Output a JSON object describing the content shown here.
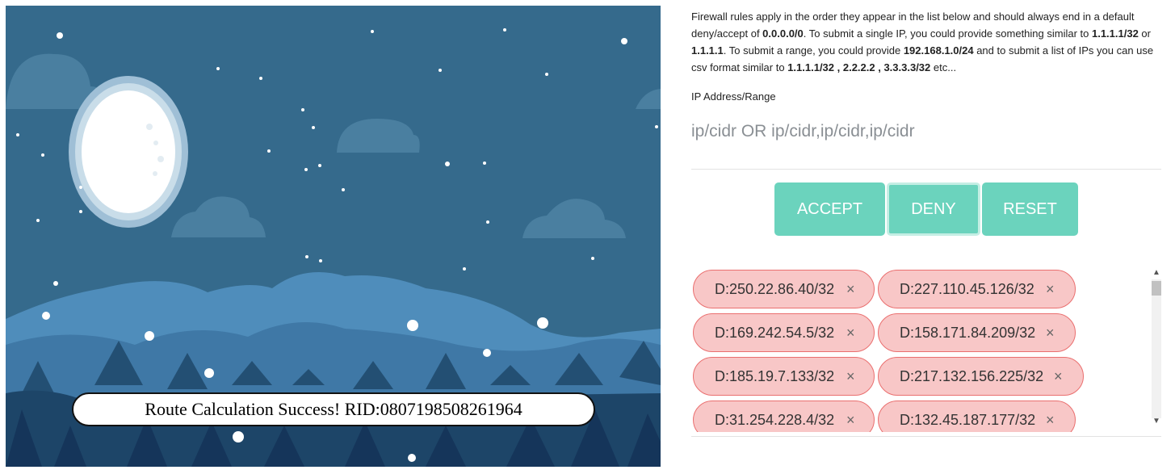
{
  "toast": {
    "message": "Route Calculation Success! RID:0807198508261964"
  },
  "firewall": {
    "intro": [
      {
        "t": "Firewall rules apply in the order they appear in the list below and should always end in a default deny/accept of "
      },
      {
        "t": "0.0.0.0/0",
        "b": true
      },
      {
        "t": ". To submit a single IP, you could provide something similar to "
      },
      {
        "t": "1.1.1.1/32",
        "b": true
      },
      {
        "t": " or "
      },
      {
        "t": "1.1.1.1",
        "b": true
      },
      {
        "t": ". To submit a range, you could provide "
      },
      {
        "t": "192.168.1.0/24",
        "b": true
      },
      {
        "t": " and to submit a list of IPs you can use csv format similar to "
      },
      {
        "t": "1.1.1.1/32 , 2.2.2.2 , 3.3.3.3/32",
        "b": true
      },
      {
        "t": " etc..."
      }
    ],
    "input_label": "IP Address/Range",
    "input_placeholder": "ip/cidr OR ip/cidr,ip/cidr,ip/cidr",
    "input_value": "",
    "buttons": {
      "accept": "ACCEPT",
      "deny": "DENY",
      "reset": "RESET"
    },
    "remove_symbol": "×",
    "rules": [
      "D:250.22.86.40/32",
      "D:227.110.45.126/32",
      "D:169.242.54.5/32",
      "D:158.171.84.209/32",
      "D:185.19.7.133/32",
      "D:217.132.156.225/32",
      "D:31.254.228.4/32",
      "D:132.45.187.177/32"
    ],
    "colors": {
      "button": "#6bd3bd",
      "tag_bg": "#f8c7c7",
      "tag_border": "#ea6f6f",
      "sky": "#356a8c"
    }
  }
}
